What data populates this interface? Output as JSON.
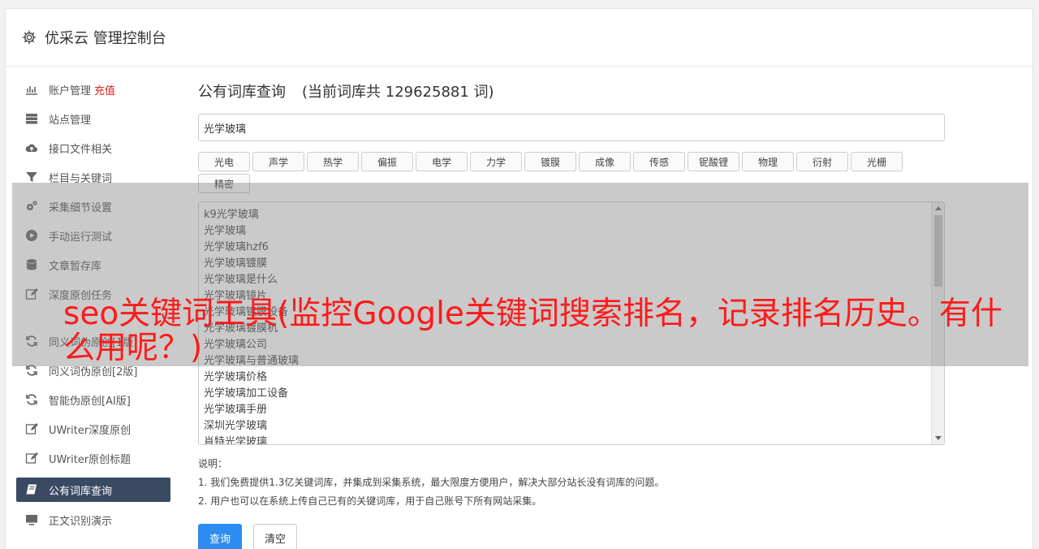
{
  "header": {
    "title": "优采云 管理控制台"
  },
  "sidebar": {
    "items": [
      {
        "label": "账户管理",
        "badge": "充值",
        "icon": "bar-chart-icon"
      },
      {
        "label": "站点管理",
        "icon": "server-icon"
      },
      {
        "label": "接口文件相关",
        "icon": "cloud-upload-icon"
      },
      {
        "label": "栏目与关键词",
        "icon": "filter-icon"
      },
      {
        "label": "采集细节设置",
        "icon": "gears-icon"
      },
      {
        "label": "手动运行测试",
        "icon": "play-circle-icon"
      },
      {
        "label": "文章暂存库",
        "icon": "database-icon"
      },
      {
        "label": "深度原创任务",
        "icon": "edit-icon"
      },
      {
        "label": "同义词伪原创[1版]",
        "icon": "refresh-icon"
      },
      {
        "label": "同义词伪原创[2版]",
        "icon": "refresh-icon"
      },
      {
        "label": "智能伪原创[AI版]",
        "icon": "refresh-icon"
      },
      {
        "label": "UWriter深度原创",
        "icon": "edit-icon"
      },
      {
        "label": "UWriter原创标题",
        "icon": "edit-icon"
      },
      {
        "label": "公有词库查询",
        "icon": "book-icon"
      },
      {
        "label": "正文识别演示",
        "icon": "monitor-icon"
      }
    ]
  },
  "main": {
    "heading": "公有词库查询",
    "count_text": "(当前词库共 129625881 词)",
    "search_value": "光学玻璃",
    "tags": [
      "光电",
      "声学",
      "热学",
      "偏振",
      "电学",
      "力学",
      "镀膜",
      "成像",
      "传感",
      "铌酸锂",
      "物理",
      "衍射",
      "光栅",
      "精密"
    ],
    "results": [
      "k9光学玻璃",
      "光学玻璃",
      "光学玻璃hzf6",
      "光学玻璃镀膜",
      "光学玻璃是什么",
      "光学玻璃镜片",
      "光学玻璃镀膜设备",
      "光学玻璃镀膜机",
      "光学玻璃公司",
      "光学玻璃与普通玻璃",
      "光学玻璃价格",
      "光学玻璃加工设备",
      "光学玻璃手册",
      "深圳光学玻璃",
      "肖特光学玻璃"
    ],
    "notes_title": "说明：",
    "notes": [
      "1. 我们免费提供1.3亿关键词库，并集成到采集系统，最大限度方便用户，解决大部分站长没有词库的问题。",
      "2. 用户也可以在系统上传自己已有的关键词库，用于自己账号下所有网站采集。"
    ],
    "query_button": "查询",
    "clear_button": "清空"
  },
  "overlay": {
    "text": "seo关键词工具(监控Google关键词搜索排名，记录排名历史。有什么用呢？)"
  },
  "colors": {
    "active_nav_bg": "#3a4a63",
    "primary_button": "#2d8cf0",
    "recharge": "#e0201b",
    "overlay_text": "#ff1a1a"
  }
}
